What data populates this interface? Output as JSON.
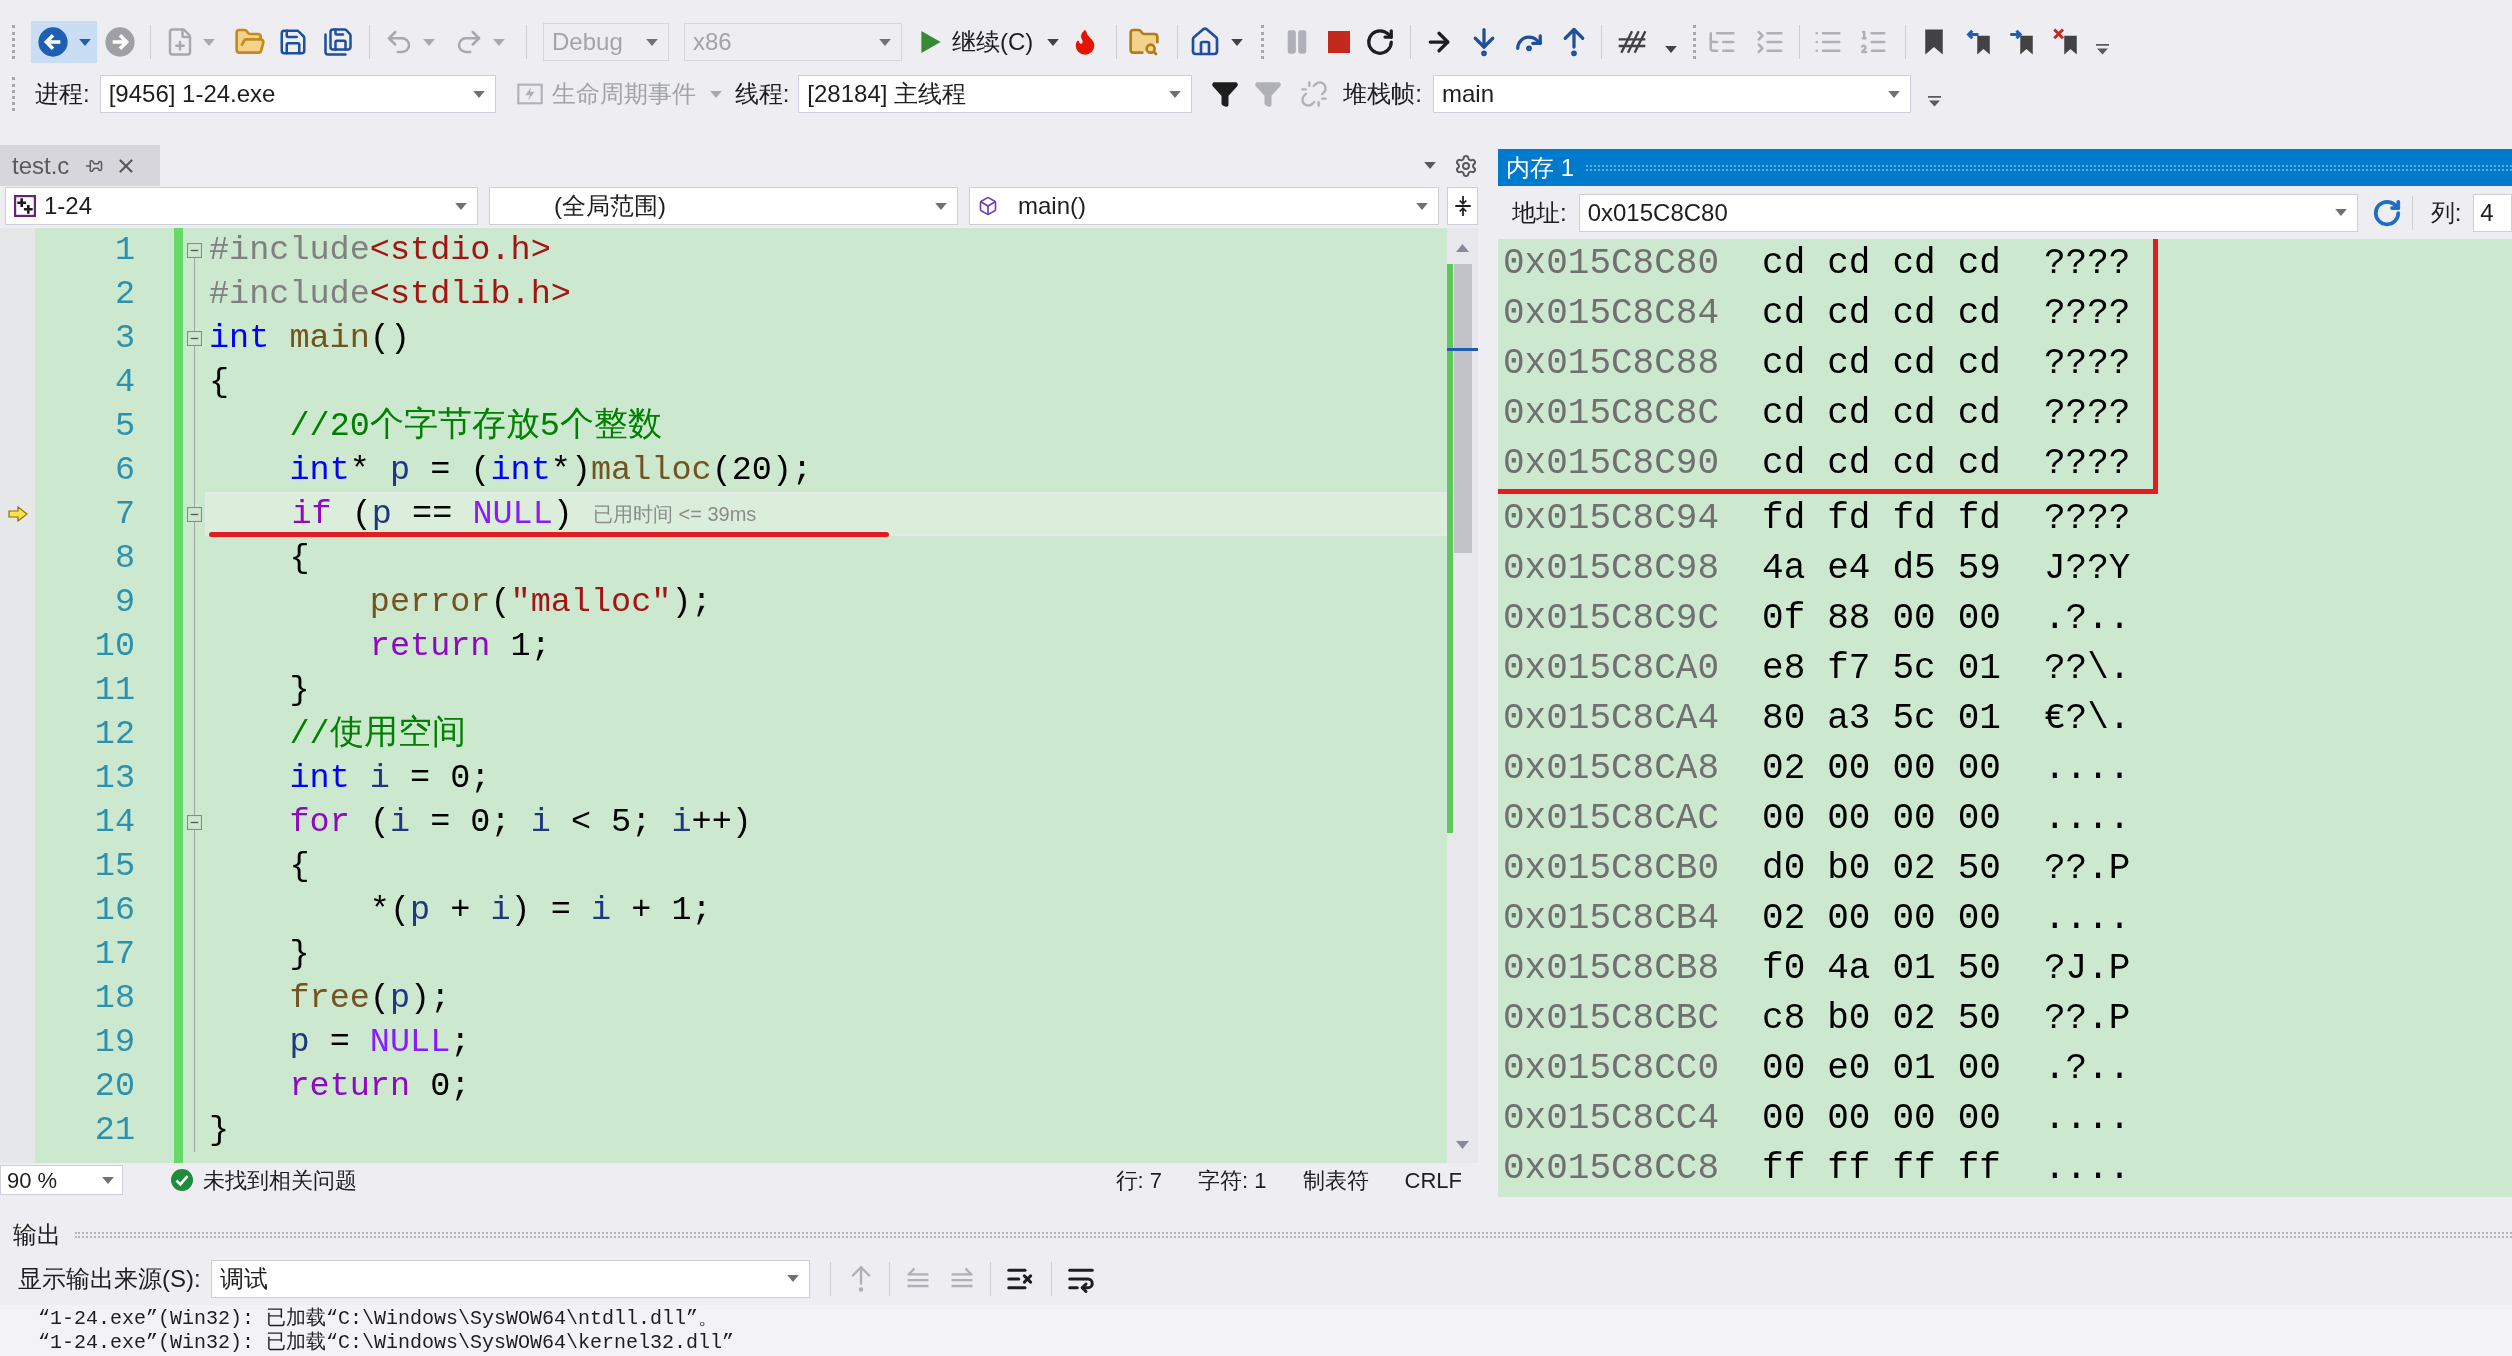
{
  "toolbar": {
    "configuration": {
      "value": "Debug",
      "disabled": true
    },
    "platform": {
      "value": "x86",
      "disabled": true
    },
    "continue_label": "继续(C)"
  },
  "debug_location": {
    "process_label": "进程:",
    "process": "[9456] 1-24.exe",
    "lifecycle": {
      "label": "生命周期事件",
      "disabled": true
    },
    "thread_label": "线程:",
    "thread": "[28184] 主线程",
    "stack_frame_label": "堆栈帧:",
    "stack_frame": "main"
  },
  "editor": {
    "tab": {
      "label": "test.c",
      "selected": true
    },
    "navigation": {
      "project": "1-24",
      "scope": "(全局范围)",
      "member": "main()"
    },
    "lines": [
      {
        "number": "1",
        "collapsible": true,
        "current": false,
        "marked": false,
        "tokens": [
          {
            "kind": "preproc",
            "text": "#include"
          },
          {
            "kind": "header",
            "text": "<stdio.h>"
          }
        ]
      },
      {
        "number": "2",
        "collapsible": false,
        "current": false,
        "marked": false,
        "tokens": [
          {
            "kind": "preproc",
            "text": "#include"
          },
          {
            "kind": "header",
            "text": "<stdlib.h>"
          }
        ]
      },
      {
        "number": "3",
        "collapsible": true,
        "current": false,
        "marked": false,
        "tokens": [
          {
            "kind": "keyword",
            "text": "int"
          },
          {
            "kind": "function",
            "text": " main"
          },
          {
            "kind": "plain",
            "text": "()"
          }
        ]
      },
      {
        "number": "4",
        "collapsible": false,
        "current": false,
        "marked": false,
        "tokens": [
          {
            "kind": "plain",
            "text": "{"
          }
        ]
      },
      {
        "number": "5",
        "collapsible": false,
        "current": false,
        "marked": false,
        "tokens": [
          {
            "kind": "comment",
            "text": "    //20个字节存放5个整数"
          }
        ]
      },
      {
        "number": "6",
        "collapsible": false,
        "current": false,
        "marked": false,
        "tokens": [
          {
            "kind": "keyword",
            "text": "    int"
          },
          {
            "kind": "plain",
            "text": "* "
          },
          {
            "kind": "variable",
            "text": "p"
          },
          {
            "kind": "plain",
            "text": " = ("
          },
          {
            "kind": "keyword",
            "text": "int"
          },
          {
            "kind": "plain",
            "text": "*)"
          },
          {
            "kind": "function",
            "text": "malloc"
          },
          {
            "kind": "plain",
            "text": "(20);"
          }
        ]
      },
      {
        "number": "7",
        "collapsible": true,
        "current": true,
        "marked": true,
        "hint": "已用时间 <= 39ms",
        "tokens": [
          {
            "kind": "control",
            "text": "    if"
          },
          {
            "kind": "plain",
            "text": " ("
          },
          {
            "kind": "variable",
            "text": "p"
          },
          {
            "kind": "plain",
            "text": " == "
          },
          {
            "kind": "macro",
            "text": "NULL"
          },
          {
            "kind": "plain",
            "text": ")"
          }
        ]
      },
      {
        "number": "8",
        "collapsible": false,
        "current": false,
        "marked": false,
        "tokens": [
          {
            "kind": "plain",
            "text": "    {"
          }
        ]
      },
      {
        "number": "9",
        "collapsible": false,
        "current": false,
        "marked": false,
        "tokens": [
          {
            "kind": "function",
            "text": "        perror"
          },
          {
            "kind": "plain",
            "text": "("
          },
          {
            "kind": "string",
            "text": "\"malloc\""
          },
          {
            "kind": "plain",
            "text": ");"
          }
        ]
      },
      {
        "number": "10",
        "collapsible": false,
        "current": false,
        "marked": false,
        "tokens": [
          {
            "kind": "control",
            "text": "        return"
          },
          {
            "kind": "plain",
            "text": " 1;"
          }
        ]
      },
      {
        "number": "11",
        "collapsible": false,
        "current": false,
        "marked": false,
        "tokens": [
          {
            "kind": "plain",
            "text": "    }"
          }
        ]
      },
      {
        "number": "12",
        "collapsible": false,
        "current": false,
        "marked": false,
        "tokens": [
          {
            "kind": "comment",
            "text": "    //使用空间"
          }
        ]
      },
      {
        "number": "13",
        "collapsible": false,
        "current": false,
        "marked": false,
        "tokens": [
          {
            "kind": "keyword",
            "text": "    int"
          },
          {
            "kind": "variable",
            "text": " i"
          },
          {
            "kind": "plain",
            "text": " = 0;"
          }
        ]
      },
      {
        "number": "14",
        "collapsible": true,
        "current": false,
        "marked": false,
        "tokens": [
          {
            "kind": "control",
            "text": "    for"
          },
          {
            "kind": "plain",
            "text": " ("
          },
          {
            "kind": "variable",
            "text": "i"
          },
          {
            "kind": "plain",
            "text": " = 0; "
          },
          {
            "kind": "variable",
            "text": "i"
          },
          {
            "kind": "plain",
            "text": " < 5; "
          },
          {
            "kind": "variable",
            "text": "i"
          },
          {
            "kind": "plain",
            "text": "++)"
          }
        ]
      },
      {
        "number": "15",
        "collapsible": false,
        "current": false,
        "marked": false,
        "tokens": [
          {
            "kind": "plain",
            "text": "    {"
          }
        ]
      },
      {
        "number": "16",
        "collapsible": false,
        "current": false,
        "marked": false,
        "tokens": [
          {
            "kind": "plain",
            "text": "        *("
          },
          {
            "kind": "variable",
            "text": "p"
          },
          {
            "kind": "plain",
            "text": " + "
          },
          {
            "kind": "variable",
            "text": "i"
          },
          {
            "kind": "plain",
            "text": ") = "
          },
          {
            "kind": "variable",
            "text": "i"
          },
          {
            "kind": "plain",
            "text": " + 1;"
          }
        ]
      },
      {
        "number": "17",
        "collapsible": false,
        "current": false,
        "marked": false,
        "tokens": [
          {
            "kind": "plain",
            "text": "    }"
          }
        ]
      },
      {
        "number": "18",
        "collapsible": false,
        "current": false,
        "marked": false,
        "tokens": [
          {
            "kind": "function",
            "text": "    free"
          },
          {
            "kind": "plain",
            "text": "("
          },
          {
            "kind": "variable",
            "text": "p"
          },
          {
            "kind": "plain",
            "text": ");"
          }
        ]
      },
      {
        "number": "19",
        "collapsible": false,
        "current": false,
        "marked": false,
        "tokens": [
          {
            "kind": "variable",
            "text": "    p"
          },
          {
            "kind": "plain",
            "text": " = "
          },
          {
            "kind": "macro",
            "text": "NULL"
          },
          {
            "kind": "plain",
            "text": ";"
          }
        ]
      },
      {
        "number": "20",
        "collapsible": false,
        "current": false,
        "marked": false,
        "tokens": [
          {
            "kind": "control",
            "text": "    return"
          },
          {
            "kind": "plain",
            "text": " 0;"
          }
        ]
      },
      {
        "number": "21",
        "collapsible": false,
        "current": false,
        "marked": false,
        "tokens": [
          {
            "kind": "plain",
            "text": "}"
          }
        ]
      }
    ],
    "status_bar": {
      "zoom": "90 %",
      "issues": "未找到相关问题",
      "line": "行: 7",
      "column": "字符: 1",
      "indentation": "制表符",
      "line_ending": "CRLF"
    }
  },
  "memory": {
    "title": "内存 1",
    "address_label": "地址:",
    "address": "0x015C8C80",
    "columns_label": "列:",
    "columns": "4",
    "rows": [
      {
        "address": "0x015C8C80",
        "bytes": [
          "cd",
          "cd",
          "cd",
          "cd"
        ],
        "text": "????",
        "marked": true
      },
      {
        "address": "0x015C8C84",
        "bytes": [
          "cd",
          "cd",
          "cd",
          "cd"
        ],
        "text": "????",
        "marked": true
      },
      {
        "address": "0x015C8C88",
        "bytes": [
          "cd",
          "cd",
          "cd",
          "cd"
        ],
        "text": "????",
        "marked": true
      },
      {
        "address": "0x015C8C8C",
        "bytes": [
          "cd",
          "cd",
          "cd",
          "cd"
        ],
        "text": "????",
        "marked": true
      },
      {
        "address": "0x015C8C90",
        "bytes": [
          "cd",
          "cd",
          "cd",
          "cd"
        ],
        "text": "????",
        "marked": true
      },
      {
        "address": "0x015C8C94",
        "bytes": [
          "fd",
          "fd",
          "fd",
          "fd"
        ],
        "text": "????",
        "marked": false
      },
      {
        "address": "0x015C8C98",
        "bytes": [
          "4a",
          "e4",
          "d5",
          "59"
        ],
        "text": "J??Y",
        "marked": false
      },
      {
        "address": "0x015C8C9C",
        "bytes": [
          "0f",
          "88",
          "00",
          "00"
        ],
        "text": ".?..",
        "marked": false
      },
      {
        "address": "0x015C8CA0",
        "bytes": [
          "e8",
          "f7",
          "5c",
          "01"
        ],
        "text": "??\\.",
        "marked": false
      },
      {
        "address": "0x015C8CA4",
        "bytes": [
          "80",
          "a3",
          "5c",
          "01"
        ],
        "text": "€?\\.",
        "marked": false
      },
      {
        "address": "0x015C8CA8",
        "bytes": [
          "02",
          "00",
          "00",
          "00"
        ],
        "text": "....",
        "marked": false
      },
      {
        "address": "0x015C8CAC",
        "bytes": [
          "00",
          "00",
          "00",
          "00"
        ],
        "text": "....",
        "marked": false
      },
      {
        "address": "0x015C8CB0",
        "bytes": [
          "d0",
          "b0",
          "02",
          "50"
        ],
        "text": "??.P",
        "marked": false
      },
      {
        "address": "0x015C8CB4",
        "bytes": [
          "02",
          "00",
          "00",
          "00"
        ],
        "text": "....",
        "marked": false
      },
      {
        "address": "0x015C8CB8",
        "bytes": [
          "f0",
          "4a",
          "01",
          "50"
        ],
        "text": "?J.P",
        "marked": false
      },
      {
        "address": "0x015C8CBC",
        "bytes": [
          "c8",
          "b0",
          "02",
          "50"
        ],
        "text": "??.P",
        "marked": false
      },
      {
        "address": "0x015C8CC0",
        "bytes": [
          "00",
          "e0",
          "01",
          "00"
        ],
        "text": ".?..",
        "marked": false
      },
      {
        "address": "0x015C8CC4",
        "bytes": [
          "00",
          "00",
          "00",
          "00"
        ],
        "text": "....",
        "marked": false
      },
      {
        "address": "0x015C8CC8",
        "bytes": [
          "ff",
          "ff",
          "ff",
          "ff"
        ],
        "text": "....",
        "marked": false
      }
    ]
  },
  "output": {
    "title": "输出",
    "source_label": "显示输出来源(S):",
    "source": "调试",
    "lines": [
      "“1-24.exe”(Win32): 已加载“C:\\Windows\\SysWOW64\\ntdll.dll”。",
      "“1-24.exe”(Win32): 已加载“C:\\Windows\\SysWOW64\\kernel32.dll”"
    ]
  }
}
